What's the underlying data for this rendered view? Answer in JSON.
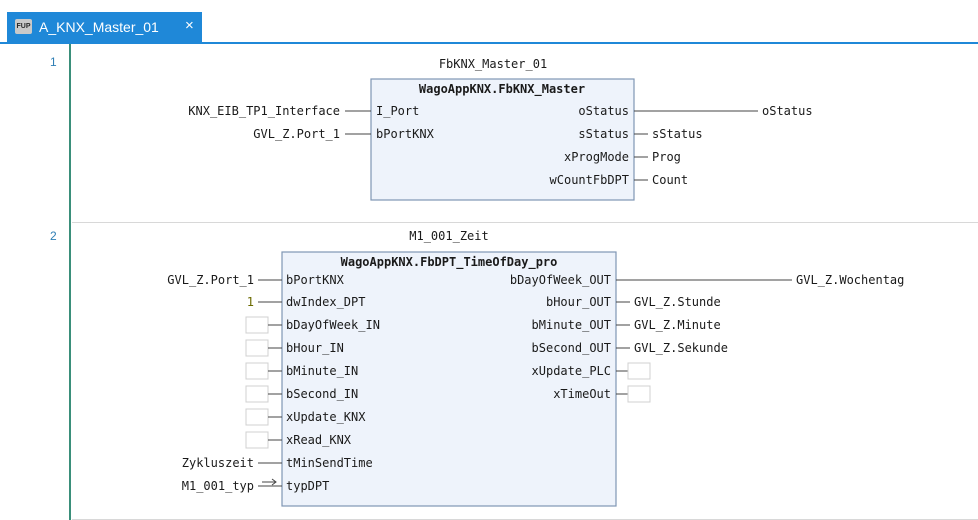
{
  "tab": {
    "icon": "fup-editor-icon",
    "title": "A_KNX_Master_01",
    "close": "×",
    "accent": "#1f88d8"
  },
  "gutter": {
    "line1": "1",
    "line2": "2"
  },
  "network1": {
    "instance": "FbKNX_Master_01",
    "block_type": "WagoAppKNX.FbKNX_Master",
    "inputs": [
      {
        "pin": "I_Port",
        "signal": "KNX_EIB_TP1_Interface"
      },
      {
        "pin": "bPortKNX",
        "signal": "GVL_Z.Port_1"
      }
    ],
    "outputs": [
      {
        "pin": "oStatus",
        "signal": "oStatus"
      },
      {
        "pin": "sStatus",
        "signal": "sStatus"
      },
      {
        "pin": "xProgMode",
        "signal": "Prog"
      },
      {
        "pin": "wCountFbDPT",
        "signal": "Count"
      }
    ]
  },
  "network2": {
    "instance": "M1_001_Zeit",
    "block_type": "WagoAppKNX.FbDPT_TimeOfDay_pro",
    "inputs": [
      {
        "pin": "bPortKNX",
        "signal": "GVL_Z.Port_1"
      },
      {
        "pin": "dwIndex_DPT",
        "signal": "1"
      },
      {
        "pin": "bDayOfWeek_IN",
        "signal": ""
      },
      {
        "pin": "bHour_IN",
        "signal": ""
      },
      {
        "pin": "bMinute_IN",
        "signal": ""
      },
      {
        "pin": "bSecond_IN",
        "signal": ""
      },
      {
        "pin": "xUpdate_KNX",
        "signal": ""
      },
      {
        "pin": "xRead_KNX",
        "signal": ""
      },
      {
        "pin": "tMinSendTime",
        "signal": "Zykluszeit"
      },
      {
        "pin": "typDPT",
        "signal": "M1_001_typ"
      }
    ],
    "outputs": [
      {
        "pin": "bDayOfWeek_OUT",
        "signal": "GVL_Z.Wochentag"
      },
      {
        "pin": "bHour_OUT",
        "signal": "GVL_Z.Stunde"
      },
      {
        "pin": "bMinute_OUT",
        "signal": "GVL_Z.Minute"
      },
      {
        "pin": "bSecond_OUT",
        "signal": "GVL_Z.Sekunde"
      },
      {
        "pin": "xUpdate_PLC",
        "signal": ""
      },
      {
        "pin": "xTimeOut",
        "signal": ""
      }
    ]
  }
}
